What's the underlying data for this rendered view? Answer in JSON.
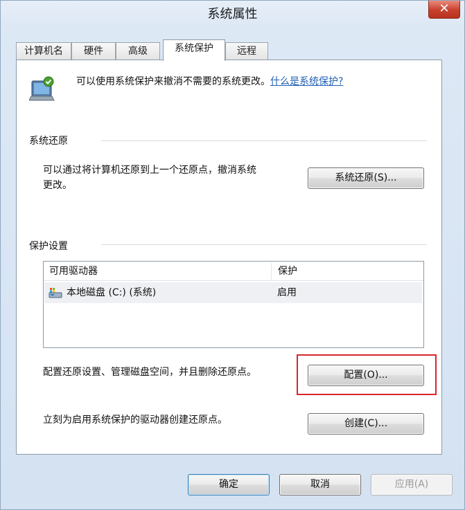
{
  "window": {
    "title": "系统属性",
    "close_symbol": "✕"
  },
  "tabs": [
    {
      "label": "计算机名",
      "active": false
    },
    {
      "label": "硬件",
      "active": false
    },
    {
      "label": "高级",
      "active": false
    },
    {
      "label": "系统保护",
      "active": true
    },
    {
      "label": "远程",
      "active": false
    }
  ],
  "intro": {
    "icon": "system-protection-icon",
    "text": "可以使用系统保护来撤消不需要的系统更改。",
    "link": "什么是系统保护?"
  },
  "restore": {
    "section_label": "系统还原",
    "description_line1": "可以通过将计算机还原到上一个还原点，撤消系统",
    "description_line2": "更改。",
    "button": "系统还原(S)..."
  },
  "protection": {
    "section_label": "保护设置",
    "columns": [
      "可用驱动器",
      "保护"
    ],
    "rows": [
      {
        "drive": "本地磁盘 (C:) (系统)",
        "protection": "启用",
        "icon": "drive-icon"
      }
    ],
    "configure_text": "配置还原设置、管理磁盘空间，并且删除还原点。",
    "configure_button": "配置(O)...",
    "create_text": "立刻为启用系统保护的驱动器创建还原点。",
    "create_button": "创建(C)..."
  },
  "footer": {
    "ok": "确定",
    "cancel": "取消",
    "apply": "应用(A)"
  },
  "colors": {
    "link": "#1e5fb4",
    "highlight_border": "#d7262b",
    "close_button": "#c8402c"
  }
}
